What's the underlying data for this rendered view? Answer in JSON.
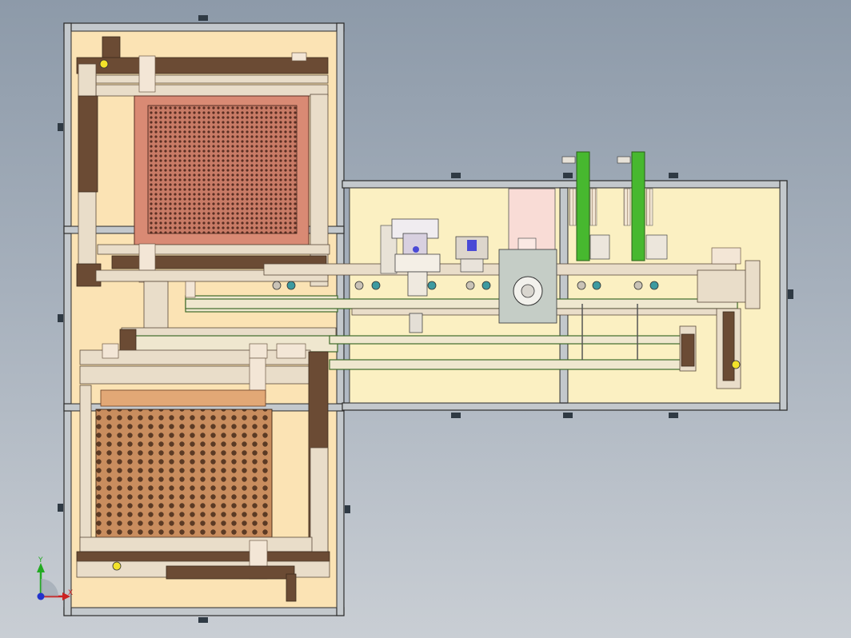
{
  "colors": {
    "background_top": "#8d9aa9",
    "frame": "#c3c8cc",
    "panel_fill": "#fbf0c2",
    "wood": "#e9ddc9",
    "dark_wood": "#6b4b34",
    "tray_red": "#d98a74",
    "tray_orange": "#c98d5e",
    "belt_green": "#3f9a2e",
    "accent_yellow": "#f2e22a",
    "accent_blue": "#4a4ad6"
  },
  "icons": [
    "coordinate-triad-icon"
  ],
  "triad": {
    "y_label": "Y",
    "x_label": "X"
  }
}
